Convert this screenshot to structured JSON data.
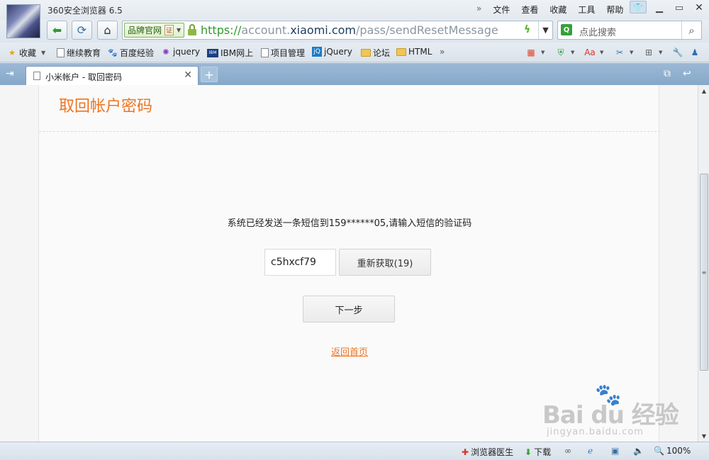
{
  "window": {
    "app_title": "360安全浏览器 6.5",
    "menu": [
      "文件",
      "查看",
      "收藏",
      "工具",
      "帮助"
    ]
  },
  "nav": {
    "brand_label": "品牌官网",
    "cert_label": "证",
    "url_scheme": "https://",
    "url_prefix": "account.",
    "url_host": "xiaomi.com",
    "url_path": "/pass/sendResetMessage",
    "search_placeholder": "点此搜索"
  },
  "bookmarks": [
    {
      "label": "收藏",
      "icon": "star-icon"
    },
    {
      "label": "继续教育",
      "icon": "page-icon"
    },
    {
      "label": "百度经验",
      "icon": "baidu-paw-icon"
    },
    {
      "label": "jquery",
      "icon": "jquery-icon"
    },
    {
      "label": "IBM网上",
      "icon": "ibm-icon"
    },
    {
      "label": "项目管理",
      "icon": "page-icon"
    },
    {
      "label": "jQuery",
      "icon": "jquery-logo-icon"
    },
    {
      "label": "论坛",
      "icon": "folder-icon"
    },
    {
      "label": "HTML",
      "icon": "folder-icon"
    }
  ],
  "tab": {
    "title": "小米帐户 - 取回密码"
  },
  "page": {
    "title": "取回帐户密码",
    "message": "系统已经发送一条短信到159******05,请输入短信的验证码",
    "code_value": "c5hxcf79",
    "resend_label": "重新获取(19)",
    "next_label": "下一步",
    "back_home_label": "返回首页"
  },
  "watermark": {
    "main": "Bai du 经验",
    "sub": "jingyan.baidu.com"
  },
  "statusbar": {
    "doctor_label": "浏览器医生",
    "download_label": "下载",
    "zoom": "100%"
  },
  "colors": {
    "accent_orange": "#ef7422",
    "url_green": "#2e9a2e",
    "tab_strip": "#9cb9d6"
  }
}
